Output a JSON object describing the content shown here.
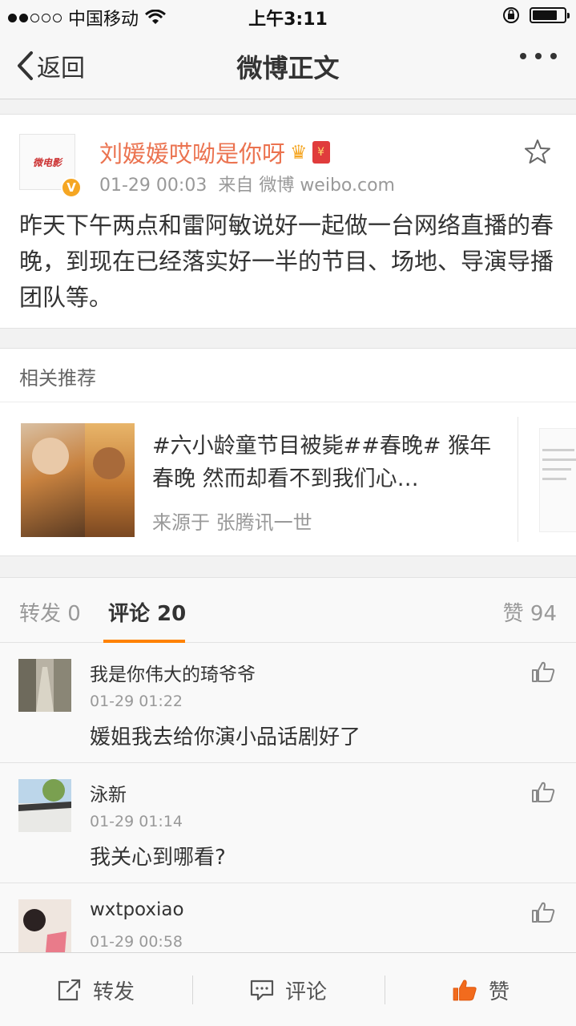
{
  "status_bar": {
    "carrier": "中国移动",
    "time": "上午3:11"
  },
  "nav": {
    "back_label": "返回",
    "title": "微博正文"
  },
  "post": {
    "author": "刘媛媛哎呦是你呀",
    "avatar_text": "微电影",
    "verified_badge": "V",
    "redpack_char": "¥",
    "time": "01-29 00:03",
    "source": "来自 微博 weibo.com",
    "text": "昨天下午两点和雷阿敏说好一起做一台网络直播的春晚，到现在已经落实好一半的节目、场地、导演导播团队等。"
  },
  "related": {
    "header": "相关推荐",
    "card": {
      "title": "#六小龄童节目被毙##春晚# 猴年春晚 然而却看不到我们心…",
      "source": "来源于 张腾讯一世"
    }
  },
  "tabs": {
    "repost": "转发 0",
    "comment": "评论 20",
    "like": "赞 94"
  },
  "comments": [
    {
      "name": "我是你伟大的琦爷爷",
      "time": "01-29 01:22",
      "text": "媛姐我去给你演小品话剧好了"
    },
    {
      "name": "泳新",
      "time": "01-29 01:14",
      "text": "我关心到哪看?"
    },
    {
      "name": "wxtpoxiao",
      "time": "01-29 00:58",
      "text": ""
    }
  ],
  "toolbar": {
    "repost": "转发",
    "comment": "评论",
    "like": "赞"
  },
  "colors": {
    "accent": "#ff8200",
    "name": "#eb7350",
    "verified": "#f5a623"
  }
}
